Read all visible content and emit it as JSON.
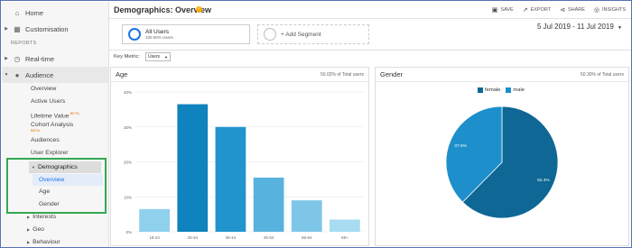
{
  "sidebar": {
    "home": "Home",
    "customisation": "Customisation",
    "reports_label": "REPORTS",
    "realtime": "Real-time",
    "audience": "Audience",
    "items": {
      "overview": "Overview",
      "active_users": "Active Users",
      "lifetime_value": "Lifetime Value",
      "lifetime_value_badge": "BETA",
      "cohort_analysis": "Cohort Analysis",
      "cohort_badge": "BETA",
      "audiences": "Audiences",
      "user_explorer": "User Explorer",
      "demographics": "Demographics",
      "demo_overview": "Overview",
      "demo_age": "Age",
      "demo_gender": "Gender",
      "interests": "Interests",
      "geo": "Geo",
      "behaviour": "Behaviour"
    }
  },
  "header": {
    "title": "Demographics: Overview",
    "save": "SAVE",
    "export": "EXPORT",
    "share": "SHARE",
    "insights": "INSIGHTS"
  },
  "segments": {
    "all_users": "All Users",
    "all_users_pct": "100.00% Users",
    "add_segment": "+ Add Segment"
  },
  "date_range": "5 Jul 2019 - 11 Jul 2019",
  "key_metric": {
    "label": "Key Metric:",
    "value": "Users"
  },
  "age_panel": {
    "title": "Age",
    "pct_of_total": "50.02% of Total users"
  },
  "gender_panel": {
    "title": "Gender",
    "pct_of_total": "50.30% of Total users"
  },
  "colors": {
    "accent": "#1a73e8",
    "highlight_box": "#34a853",
    "female": "#0e6794",
    "male": "#1d8fcb"
  },
  "chart_data": [
    {
      "type": "bar",
      "title": "Age",
      "categories": [
        "18-24",
        "25-34",
        "35-44",
        "45-54",
        "55-64",
        "65+"
      ],
      "values": [
        6.5,
        36.5,
        30,
        15.5,
        9,
        3.5
      ],
      "y_tick_labels": [
        "0%",
        "10%",
        "20%",
        "30%",
        "40%"
      ],
      "ylim": [
        0,
        40
      ],
      "bar_colors": [
        "#8fd0ec",
        "#0e83bd",
        "#2294cd",
        "#57b3de",
        "#7dc6e8",
        "#a7dcf3"
      ],
      "grid": true
    },
    {
      "type": "pie",
      "title": "Gender",
      "series": [
        {
          "name": "female",
          "value": 62.4,
          "label": "62.4%"
        },
        {
          "name": "male",
          "value": 37.6,
          "label": "37.6%"
        }
      ],
      "legend_position": "top"
    }
  ]
}
